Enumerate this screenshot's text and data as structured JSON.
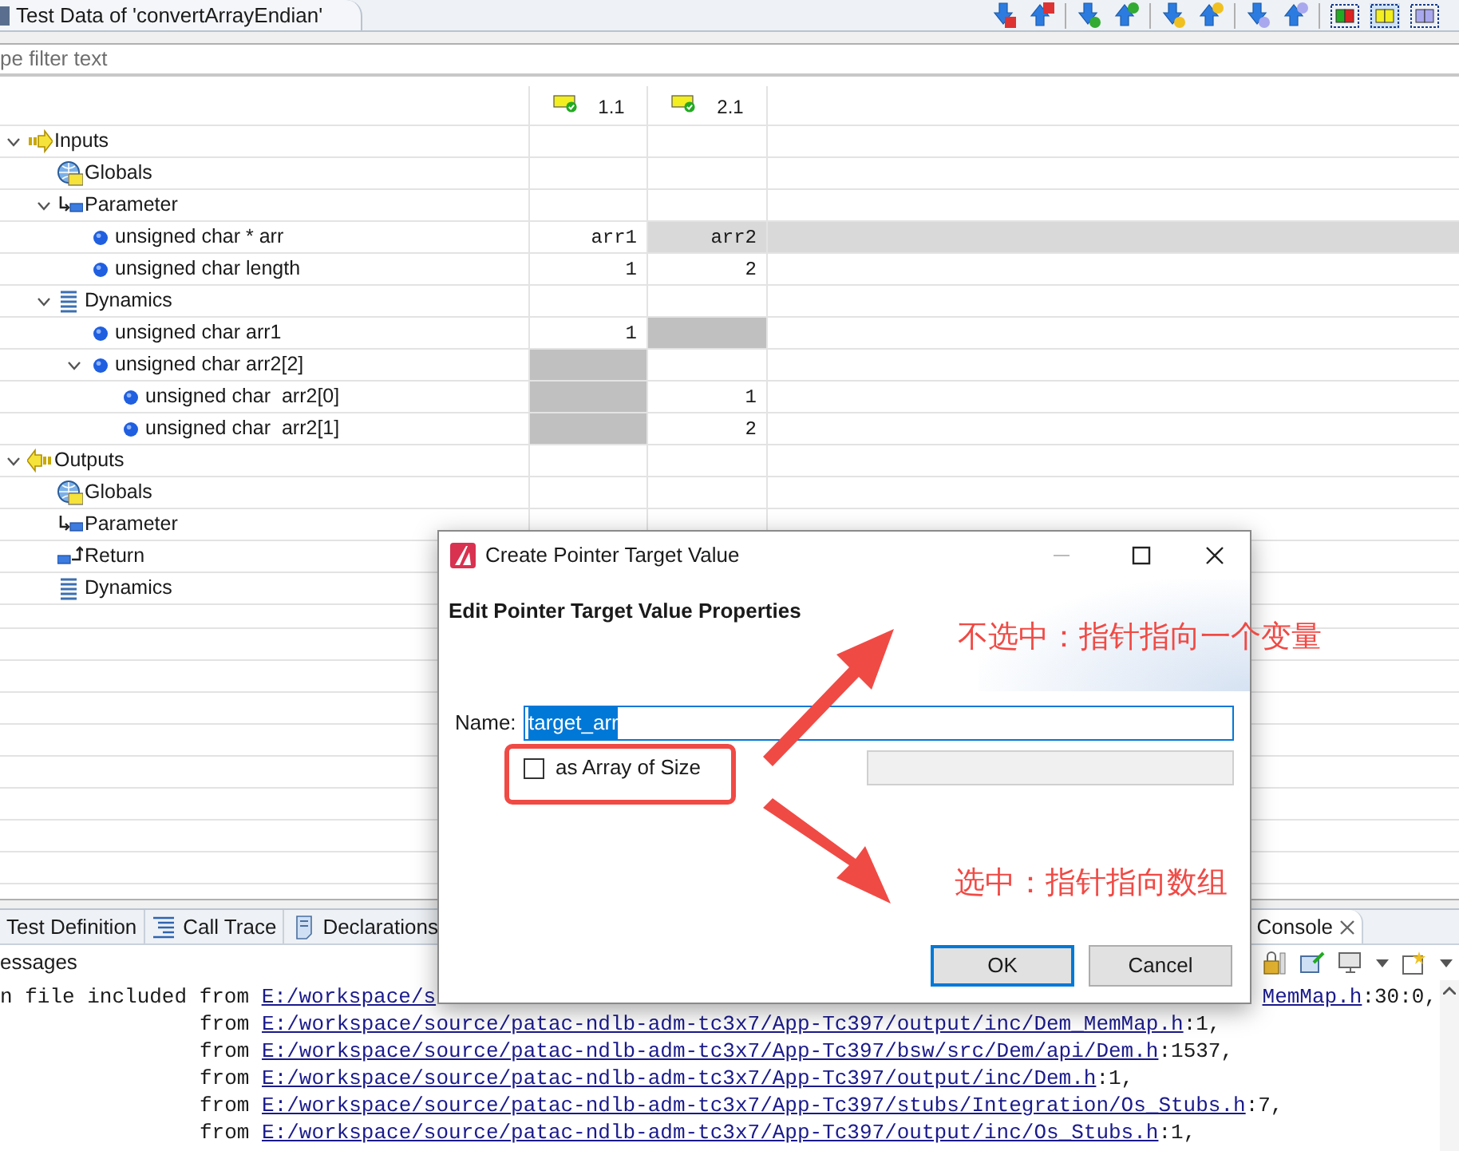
{
  "editor_tab": {
    "title": "Test Data of 'convertArrayEndian'"
  },
  "filter": {
    "placeholder": "pe filter text"
  },
  "columns": [
    "1.1",
    "2.1"
  ],
  "tree": [
    {
      "label": "Inputs",
      "kind": "inputs",
      "expanded": true,
      "children": [
        {
          "label": "Globals",
          "kind": "globals"
        },
        {
          "label": "Parameter",
          "kind": "parameter",
          "expanded": true,
          "children": [
            {
              "label": "unsigned char * arr",
              "kind": "variable",
              "cells": [
                {
                  "value": "arr1",
                  "selected": false,
                  "unused": false
                },
                {
                  "value": "arr2",
                  "selected": true,
                  "unused": false
                }
              ]
            },
            {
              "label": "unsigned char length",
              "kind": "variable",
              "cells": [
                {
                  "value": "1",
                  "selected": false,
                  "unused": false
                },
                {
                  "value": "2",
                  "selected": false,
                  "unused": false
                }
              ]
            }
          ]
        },
        {
          "label": "Dynamics",
          "kind": "dynamics",
          "expanded": true,
          "children": [
            {
              "label": "unsigned char arr1",
              "kind": "variable",
              "cells": [
                {
                  "value": "1",
                  "selected": false,
                  "unused": false
                },
                {
                  "selected": false,
                  "unused": true
                }
              ]
            },
            {
              "label": "unsigned char arr2[2]",
              "kind": "variable",
              "expanded": true,
              "cells": [
                {
                  "selected": false,
                  "unused": true
                },
                {
                  "selected": false,
                  "unused": false
                }
              ],
              "children": [
                {
                  "label": "unsigned char  arr2[0]",
                  "kind": "variable",
                  "cells": [
                    {
                      "selected": false,
                      "unused": true
                    },
                    {
                      "value": "1",
                      "selected": false,
                      "unused": false
                    }
                  ]
                },
                {
                  "label": "unsigned char  arr2[1]",
                  "kind": "variable",
                  "cells": [
                    {
                      "selected": false,
                      "unused": true
                    },
                    {
                      "value": "2",
                      "selected": false,
                      "unused": false
                    }
                  ]
                }
              ]
            }
          ]
        }
      ]
    },
    {
      "label": "Outputs",
      "kind": "outputs",
      "expanded": true,
      "children": [
        {
          "label": "Globals",
          "kind": "globals"
        },
        {
          "label": "Parameter",
          "kind": "parameter"
        },
        {
          "label": "Return",
          "kind": "return"
        },
        {
          "label": "Dynamics",
          "kind": "dynamics"
        }
      ]
    }
  ],
  "bottom_tabs": [
    {
      "label": "Test Definition",
      "kind": "definition",
      "selected": false
    },
    {
      "label": "Call Trace",
      "kind": "trace",
      "selected": false
    },
    {
      "label": "Declarations",
      "kind": "declarations",
      "selected": false
    },
    {
      "label": "Console",
      "kind": "console",
      "selected": true
    }
  ],
  "messages": {
    "label": "essages"
  },
  "console_lines": [
    {
      "kind": "first",
      "prefix": "n file included from ",
      "link": "E:/workspace/s",
      "tail_link": "MemMap.h",
      "suffix": ":30:0,"
    },
    {
      "kind": "continued",
      "prefix": "from ",
      "link": "E:/workspace/source/patac-ndlb-adm-tc3x7/App-Tc397/output/inc/Dem_MemMap.h",
      "suffix": ":1,"
    },
    {
      "kind": "continued",
      "prefix": "from ",
      "link": "E:/workspace/source/patac-ndlb-adm-tc3x7/App-Tc397/bsw/src/Dem/api/Dem.h",
      "suffix": ":1537,"
    },
    {
      "kind": "continued",
      "prefix": "from ",
      "link": "E:/workspace/source/patac-ndlb-adm-tc3x7/App-Tc397/output/inc/Dem.h",
      "suffix": ":1,"
    },
    {
      "kind": "continued",
      "prefix": "from ",
      "link": "E:/workspace/source/patac-ndlb-adm-tc3x7/App-Tc397/stubs/Integration/Os_Stubs.h",
      "suffix": ":7,"
    },
    {
      "kind": "continued",
      "prefix": "from ",
      "link": "E:/workspace/source/patac-ndlb-adm-tc3x7/App-Tc397/output/inc/Os_Stubs.h",
      "suffix": ":1,"
    }
  ],
  "dialog": {
    "title": "Create Pointer Target Value",
    "heading": "Edit Pointer Target Value Properties",
    "name_label": "Name:",
    "name_value": "target_arr",
    "array_checkbox": {
      "label": "as Array of Size",
      "checked": false
    },
    "buttons": [
      {
        "label": "OK",
        "default": true
      },
      {
        "label": "Cancel",
        "default": false
      }
    ]
  },
  "annotations": [
    "不选中：指针指向一个变量",
    "选中：指针指向数组"
  ]
}
